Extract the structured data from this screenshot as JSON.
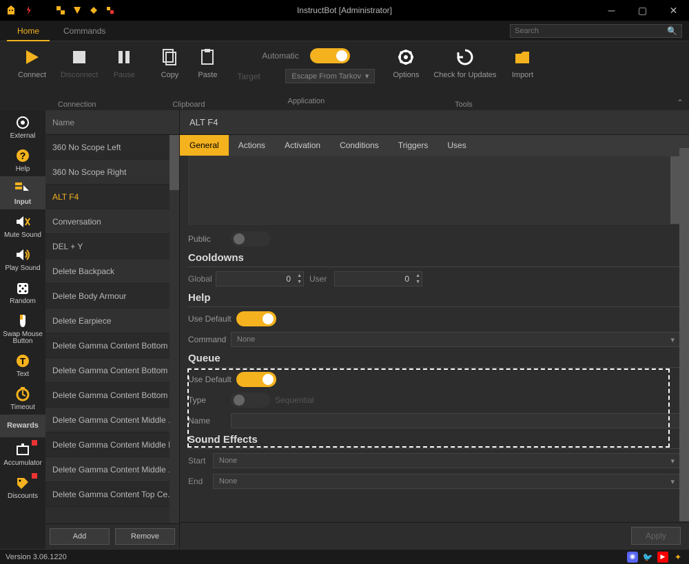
{
  "window": {
    "title": "InstructBot [Administrator]"
  },
  "menu": {
    "home": "Home",
    "commands": "Commands"
  },
  "search": {
    "placeholder": "Search"
  },
  "ribbon": {
    "connection": {
      "connect": "Connect",
      "disconnect": "Disconnect",
      "pause": "Pause",
      "group": "Connection"
    },
    "clipboard": {
      "copy": "Copy",
      "paste": "Paste",
      "group": "Clipboard"
    },
    "application": {
      "automatic": "Automatic",
      "target": "Target",
      "target_value": "Escape From Tarkov",
      "group": "Application"
    },
    "tools": {
      "options": "Options",
      "check": "Check for Updates",
      "import": "Import",
      "group": "Tools"
    }
  },
  "sidebar": {
    "items": [
      {
        "label": "External"
      },
      {
        "label": "Help"
      },
      {
        "label": "Input"
      },
      {
        "label": "Mute Sound"
      },
      {
        "label": "Play Sound"
      },
      {
        "label": "Random"
      },
      {
        "label": "Swap Mouse Button"
      },
      {
        "label": "Text"
      },
      {
        "label": "Timeout"
      },
      {
        "label": "Rewards"
      },
      {
        "label": "Accumulator"
      },
      {
        "label": "Discounts"
      }
    ]
  },
  "list": {
    "header": "Name",
    "items": [
      "360 No Scope Left",
      "360 No Scope Right",
      "ALT F4",
      "Conversation",
      "DEL + Y",
      "Delete Backpack",
      "Delete Body Armour",
      "Delete Earpiece",
      "Delete Gamma Content Bottom ...",
      "Delete Gamma Content Bottom ...",
      "Delete Gamma Content Bottom ...",
      "Delete Gamma Content Middle ...",
      "Delete Gamma Content Middle L...",
      "Delete Gamma Content Middle ...",
      "Delete Gamma Content Top Ce..."
    ],
    "selected": "ALT F4",
    "add": "Add",
    "remove": "Remove"
  },
  "content": {
    "title": "ALT F4",
    "tabs": [
      "General",
      "Actions",
      "Activation",
      "Conditions",
      "Triggers",
      "Uses"
    ],
    "public": "Public",
    "cooldowns": {
      "title": "Cooldowns",
      "global": "Global",
      "global_val": "0",
      "user": "User",
      "user_val": "0"
    },
    "help": {
      "title": "Help",
      "use_default": "Use Default",
      "command": "Command",
      "command_val": "None"
    },
    "queue": {
      "title": "Queue",
      "use_default": "Use Default",
      "type": "Type",
      "type_val": "Sequential",
      "name": "Name"
    },
    "sound": {
      "title": "Sound Effects",
      "start": "Start",
      "start_val": "None",
      "end": "End",
      "end_val": "None"
    },
    "apply": "Apply"
  },
  "status": {
    "version": "Version 3.06.1220"
  }
}
